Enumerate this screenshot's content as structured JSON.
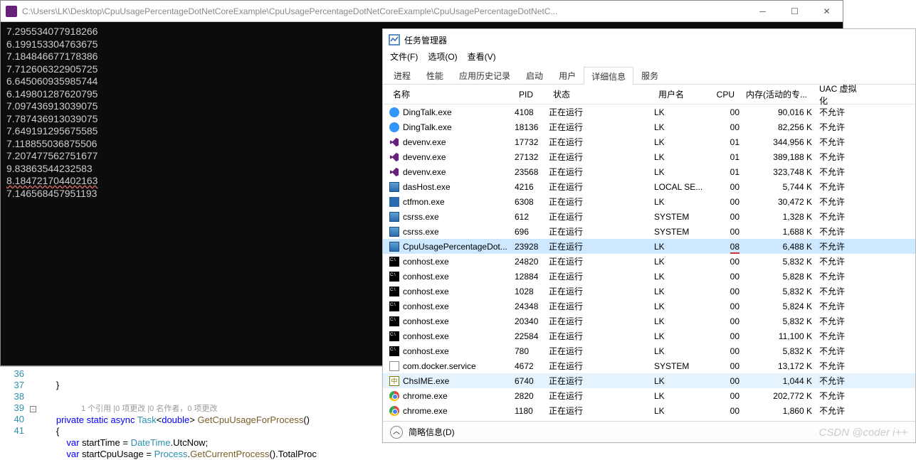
{
  "console": {
    "title": "C:\\Users\\LK\\Desktop\\CpuUsagePercentageDotNetCoreExample\\CpuUsagePercentageDotNetCoreExample\\CpuUsagePercentageDotNetC...",
    "lines": [
      "7.295534077918266",
      "6.199153304763675",
      "7.184846677178386",
      "7.712606322905725",
      "6.645060935985744",
      "6.149801287620795",
      "7.097436913039075",
      "7.787436913039075",
      "7.649191295675585",
      "7.118855036875506",
      "7.207477562751677",
      "9.83863544232583",
      "8.184721704402163",
      "7.146568457951193"
    ]
  },
  "editor": {
    "line_numbers": [
      "36",
      "37",
      " ",
      "38",
      "39",
      "40",
      "41"
    ],
    "codelens": "1 个引用 |0 项更改 |0 名作者，0 项更改",
    "lines": {
      "l36": "        }",
      "l38_pre": "        ",
      "l38_kw1": "private",
      "l38_kw2": "static",
      "l38_kw3": "async",
      "l38_type": "Task",
      "l38_kw4": "double",
      "l38_method": "GetCpuUsageForProcess",
      "l39": "        {",
      "l40_kw": "var",
      "l40_var": "startTime",
      "l40_type": "DateTime",
      "l40_prop": "UtcNow",
      "l41_kw": "var",
      "l41_var": "startCpuUsage",
      "l41_type": "Process",
      "l41_method": "GetCurrentProcess",
      "l41_prop": "TotalProc"
    }
  },
  "taskmgr": {
    "title": "任务管理器",
    "menu": {
      "file": "文件(F)",
      "options": "选项(O)",
      "view": "查看(V)"
    },
    "tabs": [
      "进程",
      "性能",
      "应用历史记录",
      "启动",
      "用户",
      "详细信息",
      "服务"
    ],
    "active_tab": "详细信息",
    "columns": {
      "name": "名称",
      "pid": "PID",
      "status": "状态",
      "user": "用户名",
      "cpu": "CPU",
      "mem": "内存(活动的专...",
      "uac": "UAC 虚拟化"
    },
    "rows": [
      {
        "icon": "ding",
        "name": "DingTalk.exe",
        "pid": "4108",
        "status": "正在运行",
        "user": "LK",
        "cpu": "00",
        "mem": "90,016 K",
        "uac": "不允许"
      },
      {
        "icon": "ding",
        "name": "DingTalk.exe",
        "pid": "18136",
        "status": "正在运行",
        "user": "LK",
        "cpu": "00",
        "mem": "82,256 K",
        "uac": "不允许"
      },
      {
        "icon": "vs",
        "name": "devenv.exe",
        "pid": "17732",
        "status": "正在运行",
        "user": "LK",
        "cpu": "01",
        "mem": "344,956 K",
        "uac": "不允许"
      },
      {
        "icon": "vs",
        "name": "devenv.exe",
        "pid": "27132",
        "status": "正在运行",
        "user": "LK",
        "cpu": "01",
        "mem": "389,188 K",
        "uac": "不允许"
      },
      {
        "icon": "vs",
        "name": "devenv.exe",
        "pid": "23568",
        "status": "正在运行",
        "user": "LK",
        "cpu": "01",
        "mem": "323,748 K",
        "uac": "不允许"
      },
      {
        "icon": "exe",
        "name": "dasHost.exe",
        "pid": "4216",
        "status": "正在运行",
        "user": "LOCAL SE...",
        "cpu": "00",
        "mem": "5,744 K",
        "uac": "不允许"
      },
      {
        "icon": "flag",
        "name": "ctfmon.exe",
        "pid": "6308",
        "status": "正在运行",
        "user": "LK",
        "cpu": "00",
        "mem": "30,472 K",
        "uac": "不允许"
      },
      {
        "icon": "exe",
        "name": "csrss.exe",
        "pid": "612",
        "status": "正在运行",
        "user": "SYSTEM",
        "cpu": "00",
        "mem": "1,328 K",
        "uac": "不允许"
      },
      {
        "icon": "exe",
        "name": "csrss.exe",
        "pid": "696",
        "status": "正在运行",
        "user": "SYSTEM",
        "cpu": "00",
        "mem": "1,688 K",
        "uac": "不允许"
      },
      {
        "icon": "exe",
        "name": "CpuUsagePercentageDot...",
        "pid": "23928",
        "status": "正在运行",
        "user": "LK",
        "cpu": "08",
        "mem": "6,488 K",
        "uac": "不允许",
        "selected": true,
        "cpu_highlight": true
      },
      {
        "icon": "conhost",
        "name": "conhost.exe",
        "pid": "24820",
        "status": "正在运行",
        "user": "LK",
        "cpu": "00",
        "mem": "5,832 K",
        "uac": "不允许"
      },
      {
        "icon": "conhost",
        "name": "conhost.exe",
        "pid": "12884",
        "status": "正在运行",
        "user": "LK",
        "cpu": "00",
        "mem": "5,828 K",
        "uac": "不允许"
      },
      {
        "icon": "conhost",
        "name": "conhost.exe",
        "pid": "1028",
        "status": "正在运行",
        "user": "LK",
        "cpu": "00",
        "mem": "5,832 K",
        "uac": "不允许"
      },
      {
        "icon": "conhost",
        "name": "conhost.exe",
        "pid": "24348",
        "status": "正在运行",
        "user": "LK",
        "cpu": "00",
        "mem": "5,824 K",
        "uac": "不允许"
      },
      {
        "icon": "conhost",
        "name": "conhost.exe",
        "pid": "20340",
        "status": "正在运行",
        "user": "LK",
        "cpu": "00",
        "mem": "5,832 K",
        "uac": "不允许"
      },
      {
        "icon": "conhost",
        "name": "conhost.exe",
        "pid": "22584",
        "status": "正在运行",
        "user": "LK",
        "cpu": "00",
        "mem": "11,100 K",
        "uac": "不允许"
      },
      {
        "icon": "conhost",
        "name": "conhost.exe",
        "pid": "780",
        "status": "正在运行",
        "user": "LK",
        "cpu": "00",
        "mem": "5,832 K",
        "uac": "不允许"
      },
      {
        "icon": "generic",
        "name": "com.docker.service",
        "pid": "4672",
        "status": "正在运行",
        "user": "SYSTEM",
        "cpu": "00",
        "mem": "13,172 K",
        "uac": "不允许"
      },
      {
        "icon": "chsime",
        "name": "ChsIME.exe",
        "pid": "6740",
        "status": "正在运行",
        "user": "LK",
        "cpu": "00",
        "mem": "1,044 K",
        "uac": "不允许",
        "hover": true
      },
      {
        "icon": "chrome",
        "name": "chrome.exe",
        "pid": "2820",
        "status": "正在运行",
        "user": "LK",
        "cpu": "00",
        "mem": "202,772 K",
        "uac": "不允许"
      },
      {
        "icon": "chrome",
        "name": "chrome.exe",
        "pid": "1180",
        "status": "正在运行",
        "user": "LK",
        "cpu": "00",
        "mem": "1,860 K",
        "uac": "不允许"
      }
    ],
    "footer": "简略信息(D)"
  },
  "watermark": "CSDN @coder i++"
}
